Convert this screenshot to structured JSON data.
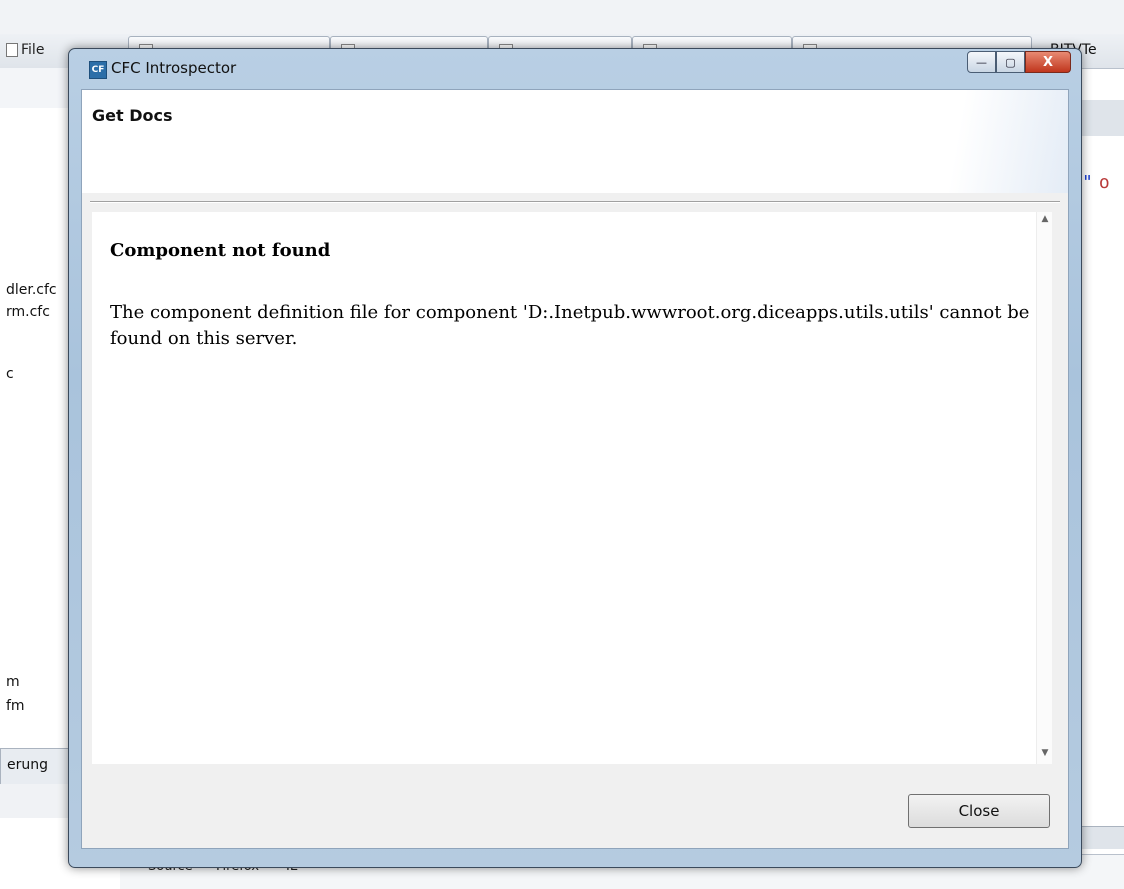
{
  "background_ide": {
    "file_tab_label": "File",
    "right_tab_label": "BITVTe",
    "tree_items": [
      "dler.cfc",
      "rm.cfc",
      "c",
      "m",
      "fm"
    ],
    "bottom_left_tab": "erung",
    "bottom_tabs": [
      "Source",
      "Firefox",
      "IE"
    ],
    "code_fragment": "\"",
    "code_fragment_2": "o"
  },
  "dialog": {
    "app_icon_text": "CF",
    "title": "CFC Introspector",
    "controls": {
      "minimize_glyph": "—",
      "maximize_glyph": "▢",
      "close_glyph": "X"
    },
    "header_title": "Get Docs",
    "message": {
      "title": "Component not found",
      "body": "The component definition file for component 'D:.Inetpub.wwwroot.org.diceapps.utils.utils' cannot be found on this server."
    },
    "scroll_up_glyph": "▲",
    "scroll_down_glyph": "▼",
    "close_button_label": "Close"
  }
}
